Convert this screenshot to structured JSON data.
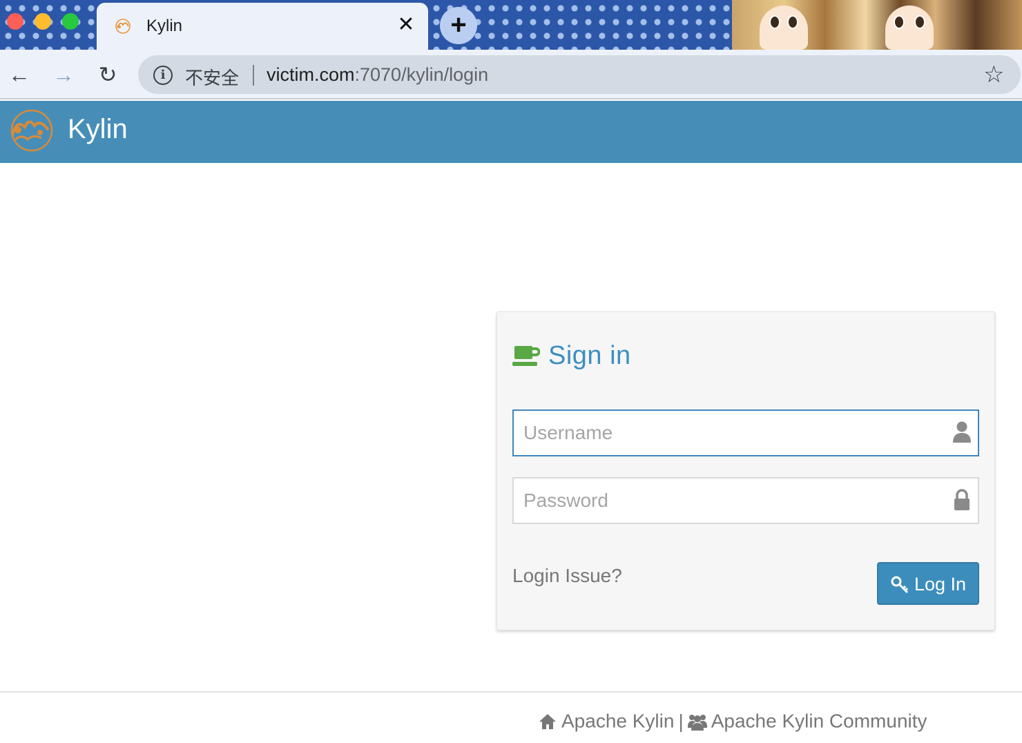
{
  "browser": {
    "tab": {
      "title": "Kylin"
    },
    "address_bar": {
      "security_label": "不安全",
      "host": "victim.com",
      "path": ":7070/kylin/login"
    }
  },
  "app": {
    "title": "Kylin",
    "brand_color": "#468eb8"
  },
  "login": {
    "heading": "Sign in",
    "username_placeholder": "Username",
    "password_placeholder": "Password",
    "issue_link": "Login Issue?",
    "submit_label": "Log In",
    "accent_color": "#3c8dbc"
  },
  "footer": {
    "link_home": "Apache Kylin",
    "separator": "|",
    "link_community": "Apache Kylin Community"
  },
  "icons": [
    "info-icon",
    "star-icon",
    "kylin-logo",
    "coffee-cup-icon",
    "user-icon",
    "lock-icon",
    "key-icon",
    "home-icon",
    "users-icon"
  ]
}
